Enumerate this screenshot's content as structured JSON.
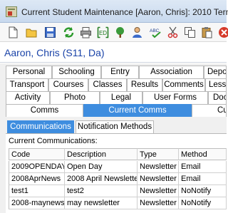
{
  "window": {
    "title": "Current Student Maintenance  [Aaron, Chris]:  2010 Term"
  },
  "toolbar": {
    "icons": [
      "new-document",
      "open-folder",
      "save",
      "refresh",
      "print",
      "id-card",
      "tree",
      "user",
      "spell-check",
      "cut",
      "copy",
      "paste",
      "close"
    ],
    "id_label": "ED"
  },
  "student": {
    "name": "Aaron, Chris (S11, Da)"
  },
  "tabs": {
    "row1": [
      "Personal",
      "Schooling",
      "Entry",
      "Association",
      "Deposits"
    ],
    "row2": [
      "Transport",
      "Courses",
      "Classes",
      "Results",
      "Comments",
      "Lessons"
    ],
    "row3": [
      "Activity",
      "Photo",
      "Legal",
      "User Forms",
      "Doc"
    ],
    "row4": [
      "Comms",
      "Current Comms",
      "Cu"
    ],
    "active": "Current Comms"
  },
  "subtabs": {
    "items": [
      "Communications",
      "Notification Methods"
    ],
    "active": "Communications"
  },
  "list": {
    "label": "Current Communications:",
    "columns": [
      "Code",
      "Description",
      "Type",
      "Method"
    ],
    "rows": [
      [
        "2009OPENDAY",
        "Open Day",
        "Newsletter",
        "Email"
      ],
      [
        "2008AprNews",
        "2008 April Newsletter",
        "Newsletter",
        "Email"
      ],
      [
        "test1",
        "test2",
        "Newsletter",
        "NoNotify"
      ],
      [
        "2008-maynews",
        "may newsletter",
        "Newsletter",
        "NoNotify"
      ]
    ]
  }
}
